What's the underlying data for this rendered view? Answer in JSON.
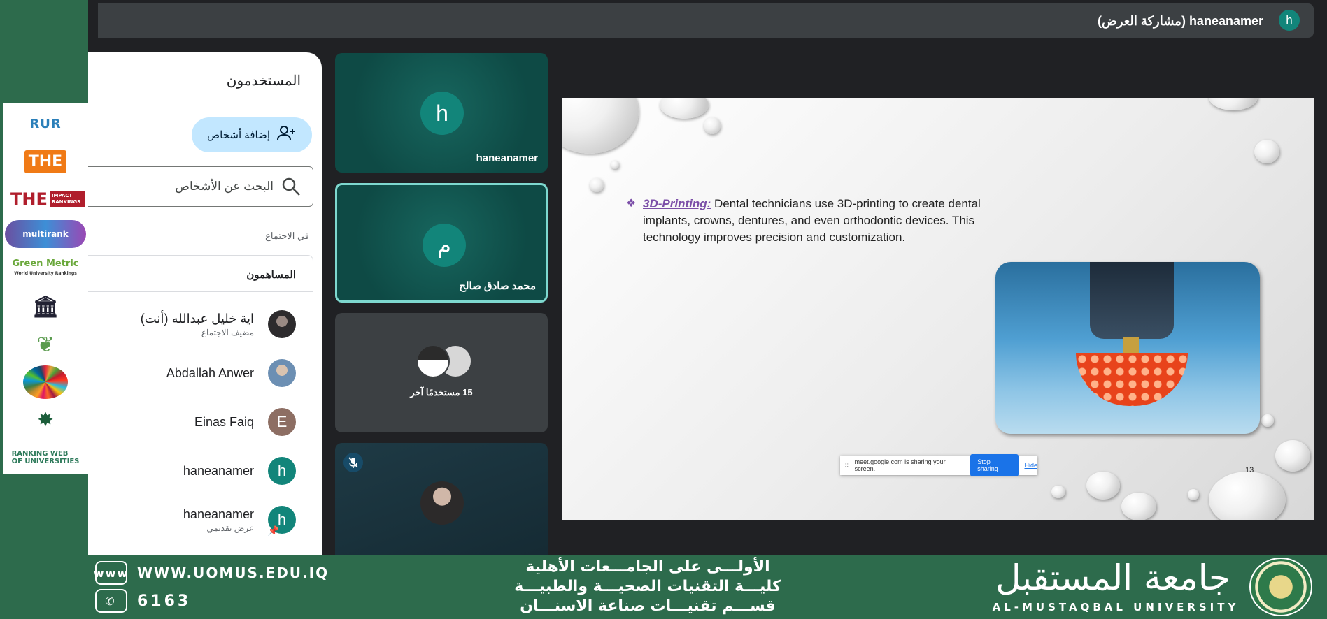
{
  "presenter_bar": {
    "title": "haneanamer (مشاركة العرض)",
    "avatar_letter": "h",
    "avatar_color": "#12857a"
  },
  "people_panel": {
    "title": "المستخدمون",
    "add_people_label": "إضافة أشخاص",
    "search_placeholder": "البحث عن الأشخاص",
    "section_label": "في الاجتماع",
    "contributors_title": "المساهمون",
    "members": [
      {
        "name": "اية خليل عبدالله (أنت)",
        "sub": "مضيف الاجتماع",
        "avatar": "",
        "avatar_type": "photo"
      },
      {
        "name": "Abdallah Anwer",
        "sub": "",
        "avatar": "",
        "avatar_type": "photo"
      },
      {
        "name": "Einas Faiq",
        "sub": "",
        "avatar": "E",
        "avatar_color": "#8d6e63"
      },
      {
        "name": "haneanamer",
        "sub": "",
        "avatar": "h",
        "avatar_color": "#12857a"
      },
      {
        "name": "haneanamer",
        "sub": "عرض تقديمي",
        "avatar": "h",
        "avatar_color": "#12857a"
      }
    ]
  },
  "tiles": [
    {
      "name": "haneanamer",
      "avatar_letter": "h"
    },
    {
      "name": "محمد صادق صالح",
      "avatar_letter": "م",
      "active_speaker": true
    },
    {
      "others_label": "15 مستخدمًا آخر"
    },
    {
      "muted": true,
      "mic_icon": "mic-off-icon"
    }
  ],
  "slide": {
    "keyword": "3D-Printing:",
    "text": " Dental technicians use 3D-printing to create dental implants, crowns, dentures, and even orthodontic devices. This technology improves precision and customization.",
    "page_number": "13",
    "bullet_icon": "diamond-bullet-icon"
  },
  "share_bar": {
    "message": "meet.google.com is sharing your screen.",
    "stop_label": "Stop sharing",
    "hide_label": "Hide"
  },
  "banner": {
    "website": "WWW.UOMUS.EDU.IQ",
    "website_badge": "www",
    "phone": "6163",
    "line1": "الأولـــى على الجامـــعات الأهلية",
    "line2": "كليـــة التقنيات الصحيـــة والطبيـــة",
    "line3": "قســـم تقنيـــات صناعة الاسنـــان",
    "university_ar": "جامعة المستقبل",
    "university_en": "AL-MUSTAQBAL UNIVERSITY"
  },
  "rankings": {
    "logos": [
      "RUR",
      "THE",
      "THE",
      "multirank",
      "Green Metric"
    ]
  },
  "colors": {
    "background_green": "#2d6b4c",
    "meet_dark": "#202124",
    "accent_teal": "#12857a",
    "add_button": "#c2e7ff",
    "stop_button": "#1a73e8"
  }
}
